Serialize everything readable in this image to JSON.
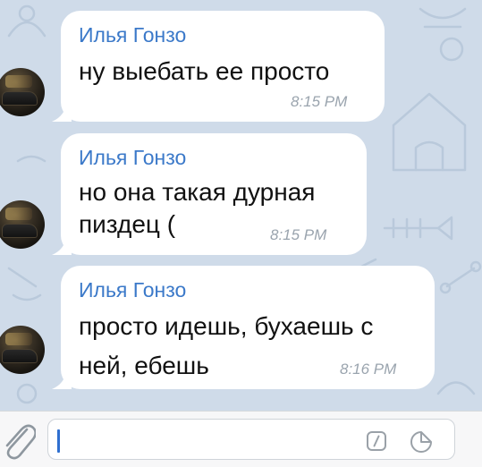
{
  "messages": [
    {
      "sender": "Илья Гонзо",
      "lines": [
        "ну выебать ее просто"
      ],
      "time": "8:15 PM"
    },
    {
      "sender": "Илья Гонзо",
      "lines": [
        "но она такая дурная",
        "пиздец ("
      ],
      "time": "8:15 PM"
    },
    {
      "sender": "Илья Гонзо",
      "lines": [
        "просто идешь, бухаешь с",
        "ней, ебешь"
      ],
      "time": "8:16 PM"
    }
  ],
  "composer": {
    "value": "",
    "icons": [
      "paperclip-icon",
      "slash-command-icon",
      "sticker-icon"
    ]
  },
  "colors": {
    "sender_name": "#3b79c9",
    "bubble": "#ffffff",
    "chat_background": "#cfdbe9",
    "timestamp": "#9aa4ae",
    "cursor": "#2f6fd0"
  }
}
